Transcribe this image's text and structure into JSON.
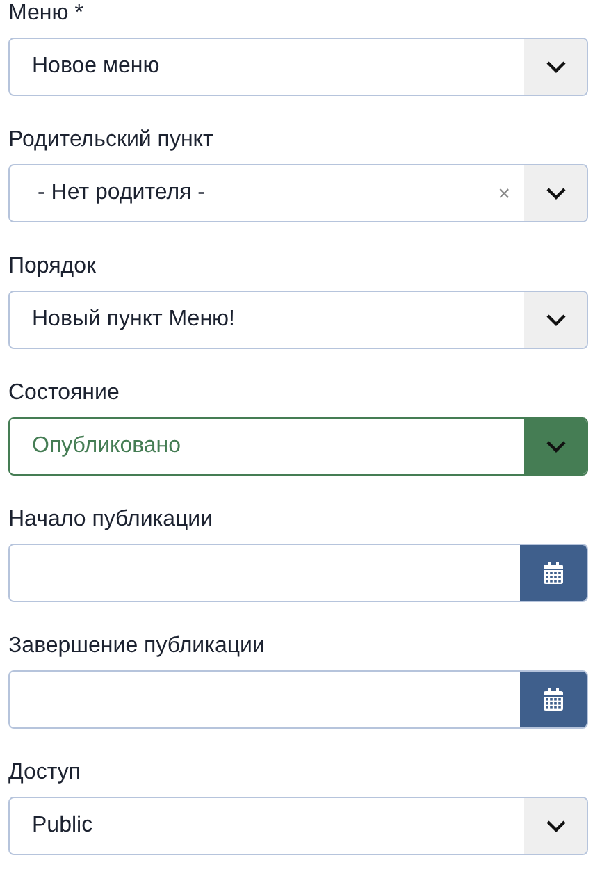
{
  "fields": [
    {
      "label": "Меню *",
      "kind": "select",
      "value": "Новое меню",
      "success": false
    },
    {
      "label": "Родительский пункт",
      "kind": "select",
      "value": "- Нет родителя -",
      "clear": "×",
      "success": false
    },
    {
      "label": "Порядок",
      "kind": "select",
      "value": "Новый пункт Меню!",
      "success": false
    },
    {
      "label": "Состояние",
      "kind": "select",
      "value": "Опубликовано",
      "success": true
    },
    {
      "label": "Начало публикации",
      "kind": "date"
    },
    {
      "label": "Завершение публикации",
      "kind": "date"
    },
    {
      "label": "Доступ",
      "kind": "select",
      "value": "Public",
      "success": false
    }
  ]
}
